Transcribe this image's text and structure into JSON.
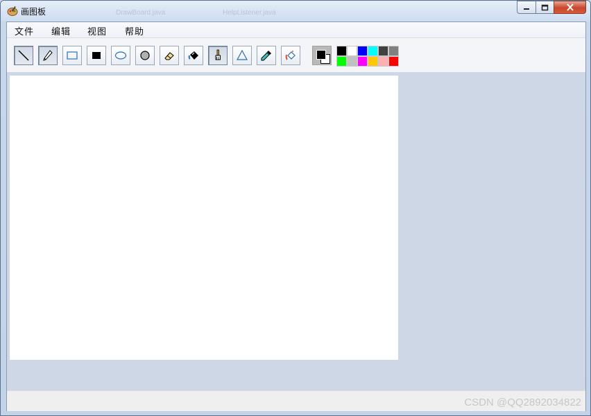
{
  "window": {
    "title": "画图板",
    "background_tabs": [
      "DrawBoard.java",
      "HelpListener.java"
    ]
  },
  "menu": {
    "items": [
      "文件",
      "编辑",
      "视图",
      "帮助"
    ]
  },
  "toolbar": {
    "tools": [
      {
        "icon": "line-icon"
      },
      {
        "icon": "pencil-icon",
        "selected": true
      },
      {
        "icon": "rectangle-icon"
      },
      {
        "icon": "filled-rectangle-icon"
      },
      {
        "icon": "ellipse-icon"
      },
      {
        "icon": "filled-ellipse-icon"
      },
      {
        "icon": "eraser-icon"
      },
      {
        "icon": "fill-bucket-icon"
      },
      {
        "icon": "brush-icon"
      },
      {
        "icon": "triangle-icon"
      },
      {
        "icon": "eyedropper-icon"
      },
      {
        "icon": "spray-icon"
      }
    ],
    "foreground_color": "#000000",
    "background_color": "#FFFFFF"
  },
  "palette": {
    "colors": [
      "#000000",
      "#FFFFFF",
      "#0000FF",
      "#00FFFF",
      "#404040",
      "#808080",
      "#00FF00",
      "#C0C0C0",
      "#FF00FF",
      "#FFC800",
      "#FFAFAF",
      "#FF0000"
    ]
  },
  "watermark": "CSDN @QQ2892034822"
}
